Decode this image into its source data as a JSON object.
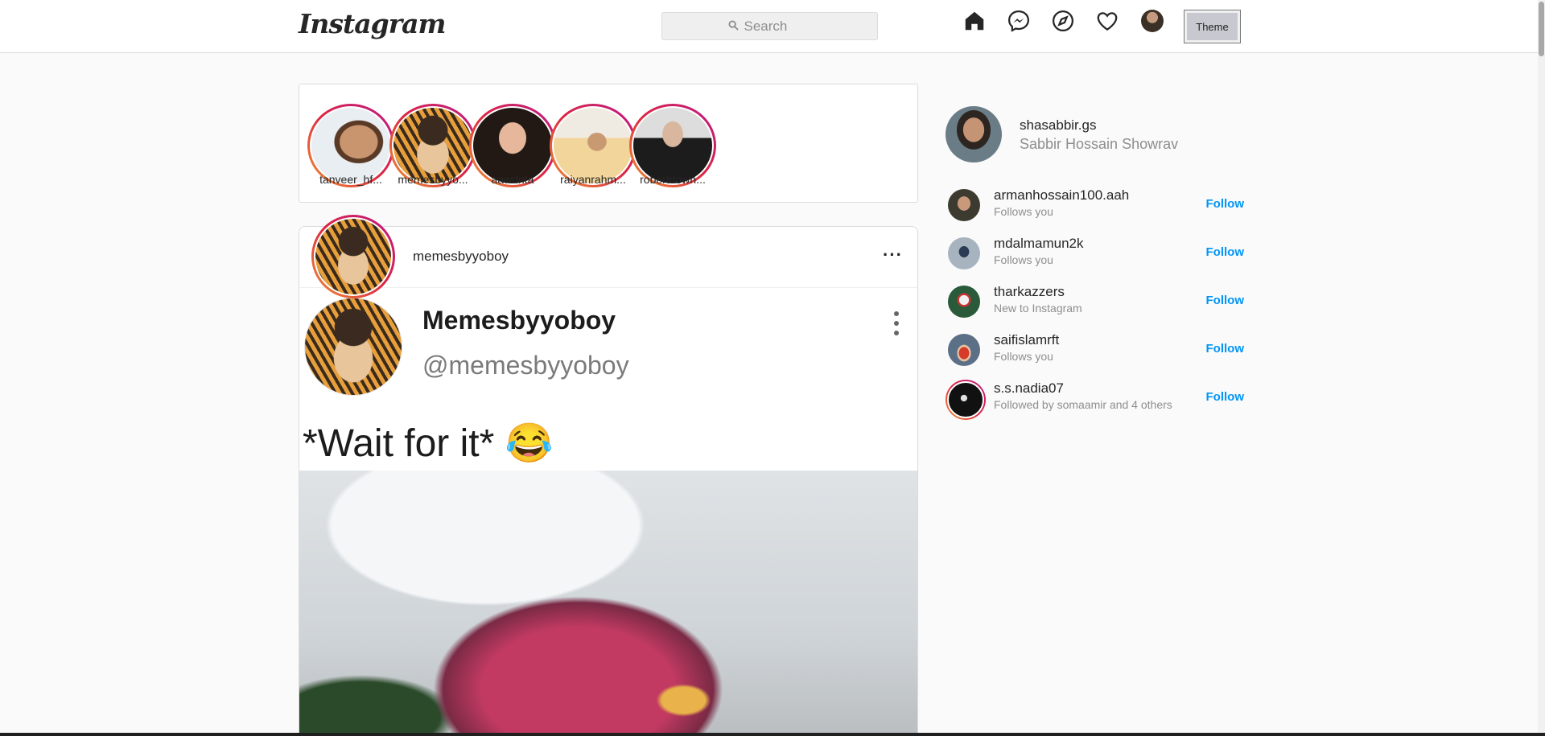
{
  "header": {
    "logo": "Instagram",
    "search_placeholder": "Search",
    "theme_label": "Theme",
    "icons": [
      "home-icon",
      "messenger-icon",
      "explore-icon",
      "heart-icon"
    ]
  },
  "stories": [
    {
      "username": "tanveer_hf..."
    },
    {
      "username": "memesbyyo..."
    },
    {
      "username": "aawdrita"
    },
    {
      "username": "raiyanrahm..."
    },
    {
      "username": "robertdown..."
    }
  ],
  "post": {
    "username": "memesbyyoboy",
    "tweet_name": "Memesbyyoboy",
    "tweet_handle": "@memesbyyoboy",
    "tweet_text": "*Wait for it* 😂"
  },
  "sidebar": {
    "username": "shasabbir.gs",
    "full_name": "Sabbir Hossain Showrav",
    "suggestions": [
      {
        "username": "armanhossain100.aah",
        "subtitle": "Follows you",
        "action": "Follow"
      },
      {
        "username": "mdalmamun2k",
        "subtitle": "Follows you",
        "action": "Follow"
      },
      {
        "username": "tharkazzers",
        "subtitle": "New to Instagram",
        "action": "Follow"
      },
      {
        "username": "saifislamrft",
        "subtitle": "Follows you",
        "action": "Follow"
      },
      {
        "username": "s.s.nadia07",
        "subtitle": "Followed by somaamir and 4 others",
        "action": "Follow"
      }
    ]
  },
  "colors": {
    "link_blue": "#0095f6",
    "story_ring_start": "#f09433",
    "story_ring_mid": "#dc2743",
    "story_ring_end": "#bc1888"
  }
}
